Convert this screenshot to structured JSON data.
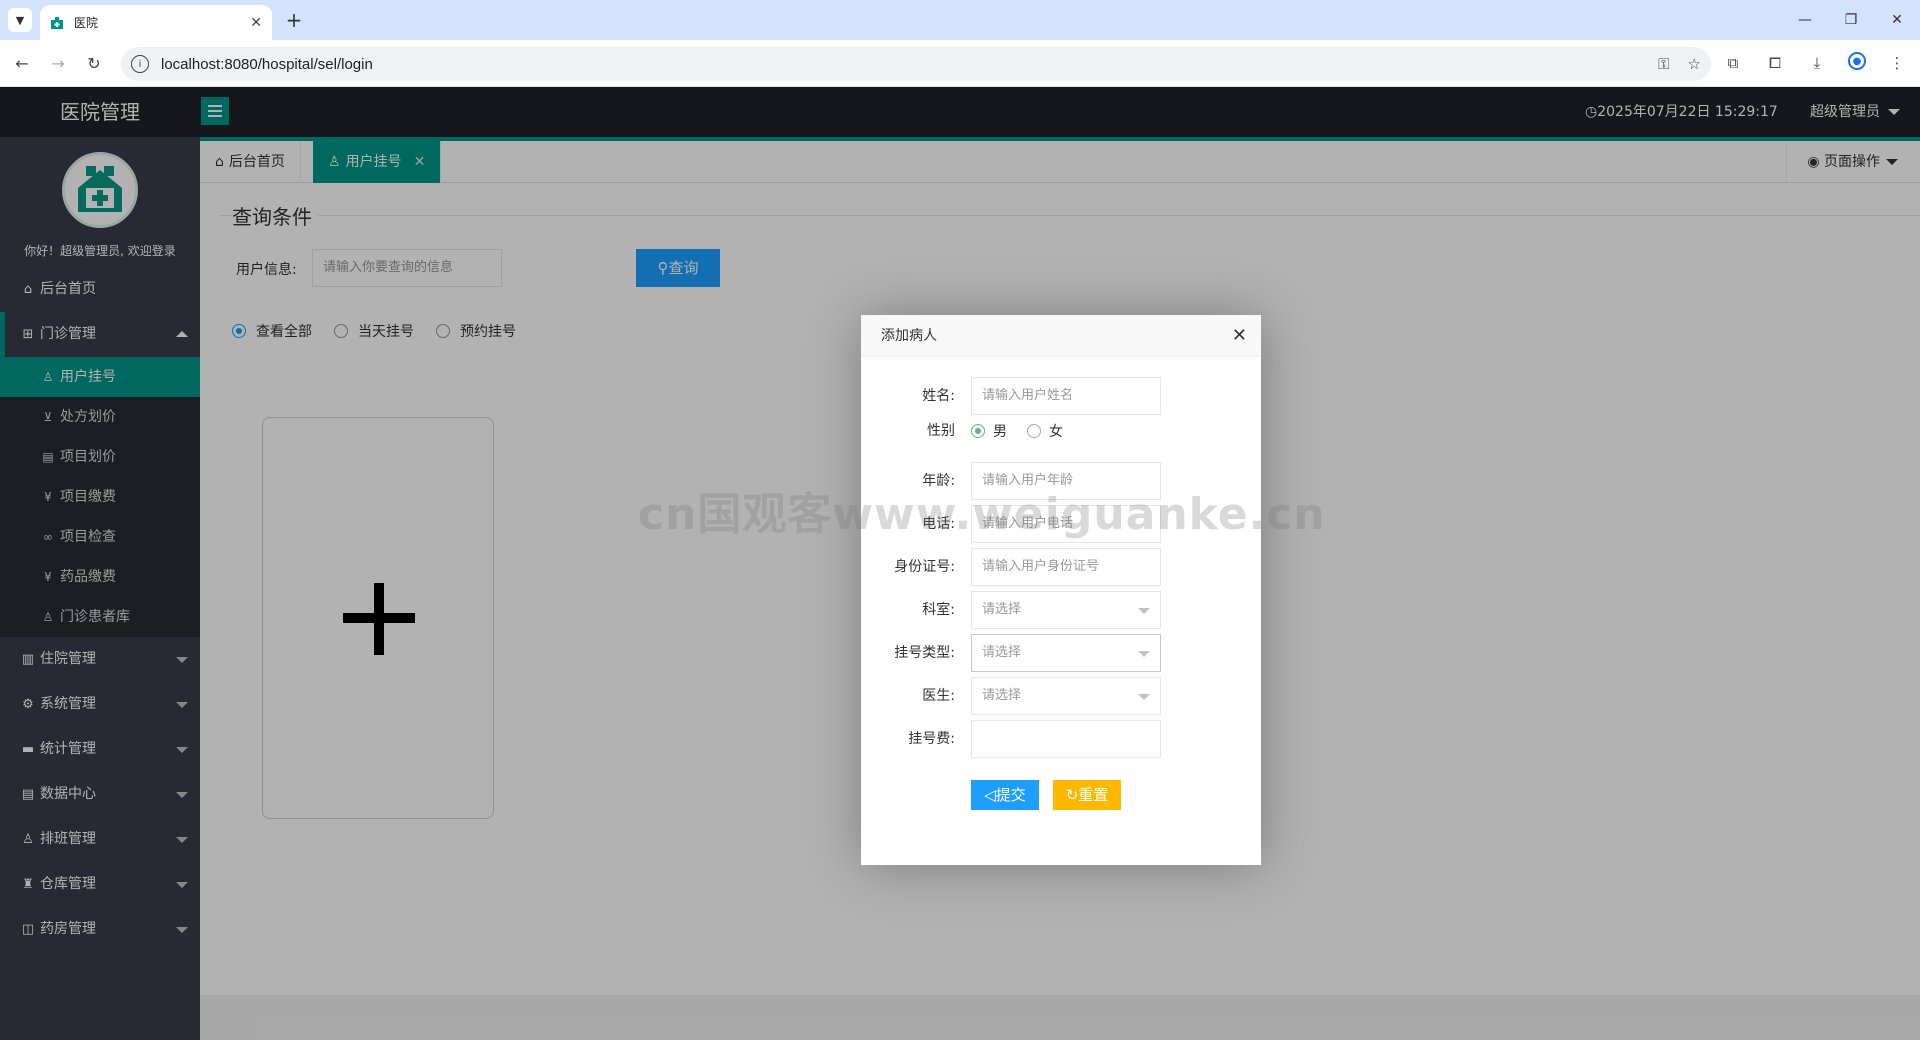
{
  "browser": {
    "tab_title": "医院",
    "url": "localhost:8080/hospital/sel/login"
  },
  "header": {
    "logo_text": "医院管理",
    "datetime": "2025年07月22日 15:29:17",
    "user_menu": "超级管理员"
  },
  "sidebar": {
    "welcome": "你好！超级管理员, 欢迎登录",
    "home": "后台首页",
    "outpatient": {
      "label": "门诊管理",
      "items": [
        {
          "label": "用户挂号",
          "icon": "user-icon"
        },
        {
          "label": "处方划价",
          "icon": "cart-icon"
        },
        {
          "label": "项目划价",
          "icon": "doc-icon"
        },
        {
          "label": "项目缴费",
          "icon": "yen-icon"
        },
        {
          "label": "项目检查",
          "icon": "link-icon"
        },
        {
          "label": "药品缴费",
          "icon": "yen-icon"
        },
        {
          "label": "门诊患者库",
          "icon": "user-icon"
        }
      ]
    },
    "menus": [
      {
        "label": "住院管理",
        "icon": "building-icon"
      },
      {
        "label": "系统管理",
        "icon": "gear-icon"
      },
      {
        "label": "统计管理",
        "icon": "chat-icon"
      },
      {
        "label": "数据中心",
        "icon": "doc-icon"
      },
      {
        "label": "排班管理",
        "icon": "user-icon"
      },
      {
        "label": "仓库管理",
        "icon": "house-icon"
      },
      {
        "label": "药房管理",
        "icon": "book-icon"
      }
    ]
  },
  "tabs": {
    "home": "后台首页",
    "active": "用户挂号",
    "page_ops": "页面操作"
  },
  "query": {
    "section_title": "查询条件",
    "label": "用户信息:",
    "placeholder": "请输入你要查询的信息",
    "button": "查询",
    "filters": [
      "查看全部",
      "当天挂号",
      "预约挂号"
    ],
    "selected_filter": "查看全部"
  },
  "modal": {
    "title": "添加病人",
    "name_label": "姓名:",
    "name_placeholder": "请输入用户姓名",
    "gender_label": "性别",
    "gender_options": [
      "男",
      "女"
    ],
    "gender_selected": "男",
    "age_label": "年龄:",
    "age_placeholder": "请输入用户年龄",
    "phone_label": "电话:",
    "phone_placeholder": "请输入用户电话",
    "id_label": "身份证号:",
    "id_placeholder": "请输入用户身份证号",
    "dept_label": "科室:",
    "dept_value": "请选择",
    "type_label": "挂号类型:",
    "type_value": "请选择",
    "doctor_label": "医生:",
    "doctor_value": "请选择",
    "fee_label": "挂号费:",
    "fee_value": "",
    "submit": "提交",
    "reset": "重置"
  },
  "watermark": "cn国观客www.weiguanke.cn",
  "colors": {
    "accent": "#009688",
    "primary_button": "#1e9fff",
    "warning_button": "#ffb800",
    "sidebar_bg": "#393d49",
    "header_bg": "#20222a"
  }
}
